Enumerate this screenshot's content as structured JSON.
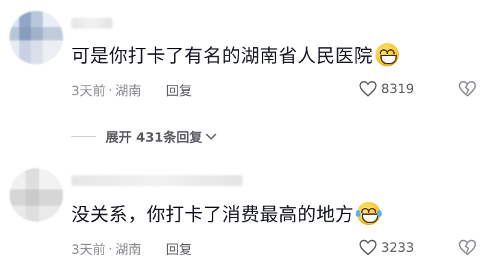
{
  "comments": [
    {
      "text": "可是你打卡了有名的湖南省人民医院",
      "emoji": "grinning-emoji",
      "time": "3天前",
      "separator": "·",
      "location": "湖南",
      "reply_label": "回复",
      "likes": "8319"
    },
    {
      "text": "没关系，你打卡了消费最高的地方",
      "emoji": "laughing-tears-emoji",
      "time": "3天前",
      "separator": "·",
      "location": "湖南",
      "reply_label": "回复",
      "likes": "3233"
    }
  ],
  "expand": {
    "label": "展开 431条回复"
  },
  "colors": {
    "text": "#161823",
    "meta": "#8a8b91",
    "secondary": "#5c5d63"
  }
}
